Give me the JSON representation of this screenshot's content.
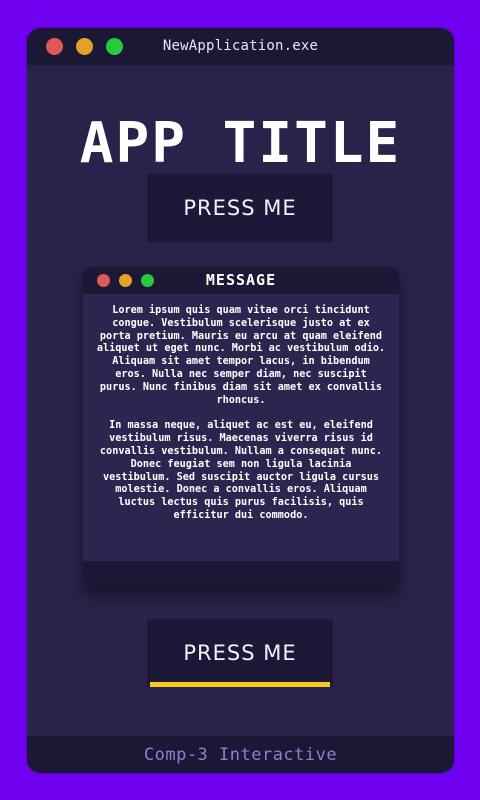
{
  "window": {
    "title": "NewApplication.exe"
  },
  "heading": "APP TITLE",
  "buttons": {
    "top_label": "PRESS ME",
    "bottom_label": "PRESS ME"
  },
  "message_dialog": {
    "title": "MESSAGE",
    "paragraphs": [
      "Lorem ipsum quis quam vitae orci tincidunt congue. Vestibulum scelerisque justo at ex porta pretium. Mauris eu arcu at quam eleifend aliquet ut eget nunc. Morbi ac vestibulum odio. Aliquam sit amet tempor lacus, in bibendum eros. Nulla nec semper diam, nec suscipit purus. Nunc finibus diam sit amet ex convallis rhoncus.",
      "In massa neque, aliquet ac est eu, eleifend vestibulum risus. Maecenas viverra risus id convallis vestibulum. Nullam a consequat nunc. Donec feugiat sem non ligula lacinia vestibulum. Sed suscipit auctor ligula cursus molestie. Donec a convallis eros. Aliquam luctus lectus quis purus facilisis, quis efficitur dui commodo."
    ]
  },
  "footer": {
    "text": "Comp-3 Interactive"
  },
  "icons": {
    "close": "close-dot-icon",
    "minimize": "minimize-dot-icon",
    "maximize": "maximize-dot-icon"
  },
  "colors": {
    "background": "#6f00f0",
    "window": "#2a224a",
    "bar": "#1b1836",
    "close": "#e05757",
    "minimize": "#e3a126",
    "maximize": "#27c93f",
    "accent": "#f5cc1a",
    "footer_text": "#8f7ed1"
  }
}
